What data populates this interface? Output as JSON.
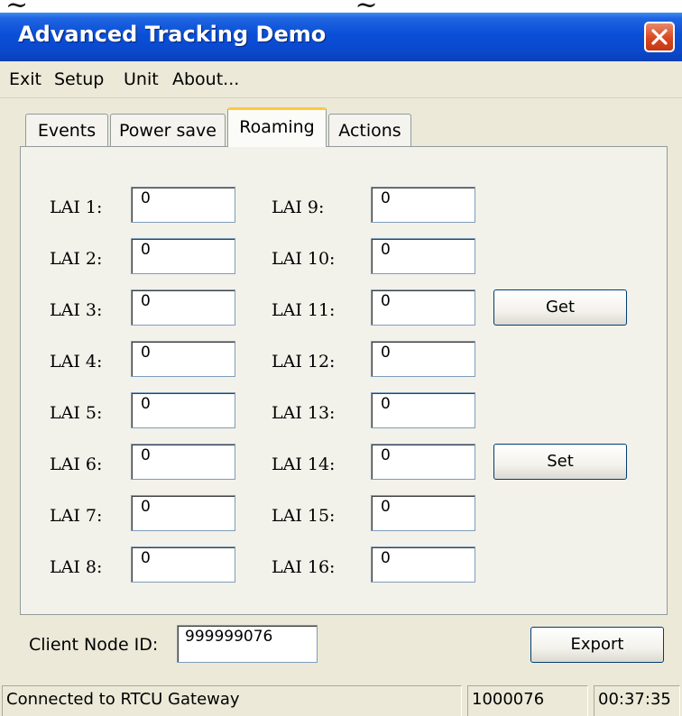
{
  "window": {
    "title": "Advanced Tracking Demo"
  },
  "menu": [
    "Exit",
    "Setup",
    "Unit",
    "About..."
  ],
  "tabs": [
    {
      "label": "Events",
      "active": false
    },
    {
      "label": "Power save",
      "active": false
    },
    {
      "label": "Roaming",
      "active": true
    },
    {
      "label": "Actions",
      "active": false
    }
  ],
  "roaming": {
    "left": [
      {
        "label": "LAI 1:",
        "value": "0"
      },
      {
        "label": "LAI 2:",
        "value": "0"
      },
      {
        "label": "LAI 3:",
        "value": "0"
      },
      {
        "label": "LAI 4:",
        "value": "0"
      },
      {
        "label": "LAI 5:",
        "value": "0"
      },
      {
        "label": "LAI 6:",
        "value": "0"
      },
      {
        "label": "LAI 7:",
        "value": "0"
      },
      {
        "label": "LAI 8:",
        "value": "0"
      }
    ],
    "right": [
      {
        "label": "LAI 9:",
        "value": "0"
      },
      {
        "label": "LAI 10:",
        "value": "0"
      },
      {
        "label": "LAI 11:",
        "value": "0"
      },
      {
        "label": "LAI 12:",
        "value": "0"
      },
      {
        "label": "LAI 13:",
        "value": "0"
      },
      {
        "label": "LAI 14:",
        "value": "0"
      },
      {
        "label": "LAI 15:",
        "value": "0"
      },
      {
        "label": "LAI 16:",
        "value": "0"
      }
    ],
    "get_label": "Get",
    "set_label": "Set"
  },
  "footer": {
    "client_node_label": "Client Node ID:",
    "client_node_value": "999999076",
    "export_label": "Export"
  },
  "status": {
    "connection": "Connected to RTCU Gateway",
    "node": "1000076",
    "time": "00:37:35"
  }
}
